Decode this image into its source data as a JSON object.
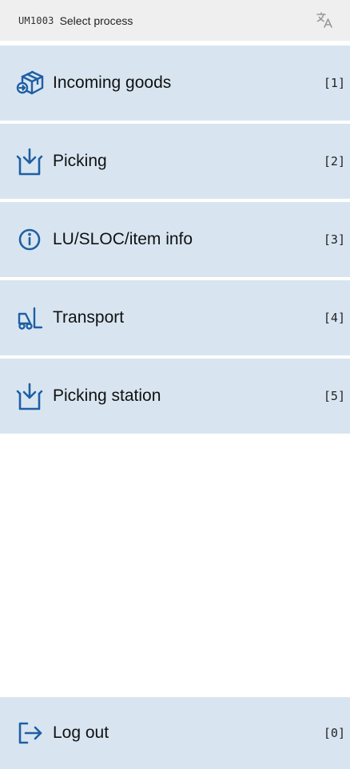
{
  "header": {
    "code": "UM1003",
    "title": "Select process",
    "language_icon": "translate-icon"
  },
  "menu": {
    "items": [
      {
        "label": "Incoming goods",
        "key": "[1]",
        "icon": "package-incoming-icon"
      },
      {
        "label": "Picking",
        "key": "[2]",
        "icon": "picking-icon"
      },
      {
        "label": "LU/SLOC/item info",
        "key": "[3]",
        "icon": "info-icon"
      },
      {
        "label": "Transport",
        "key": "[4]",
        "icon": "forklift-icon"
      },
      {
        "label": "Picking station",
        "key": "[5]",
        "icon": "picking-icon"
      }
    ]
  },
  "logout": {
    "label": "Log out",
    "key": "[0]",
    "icon": "logout-icon"
  },
  "colors": {
    "header_bg": "#efefef",
    "item_bg": "#d8e5f1",
    "icon_blue": "#1f5fa3"
  }
}
